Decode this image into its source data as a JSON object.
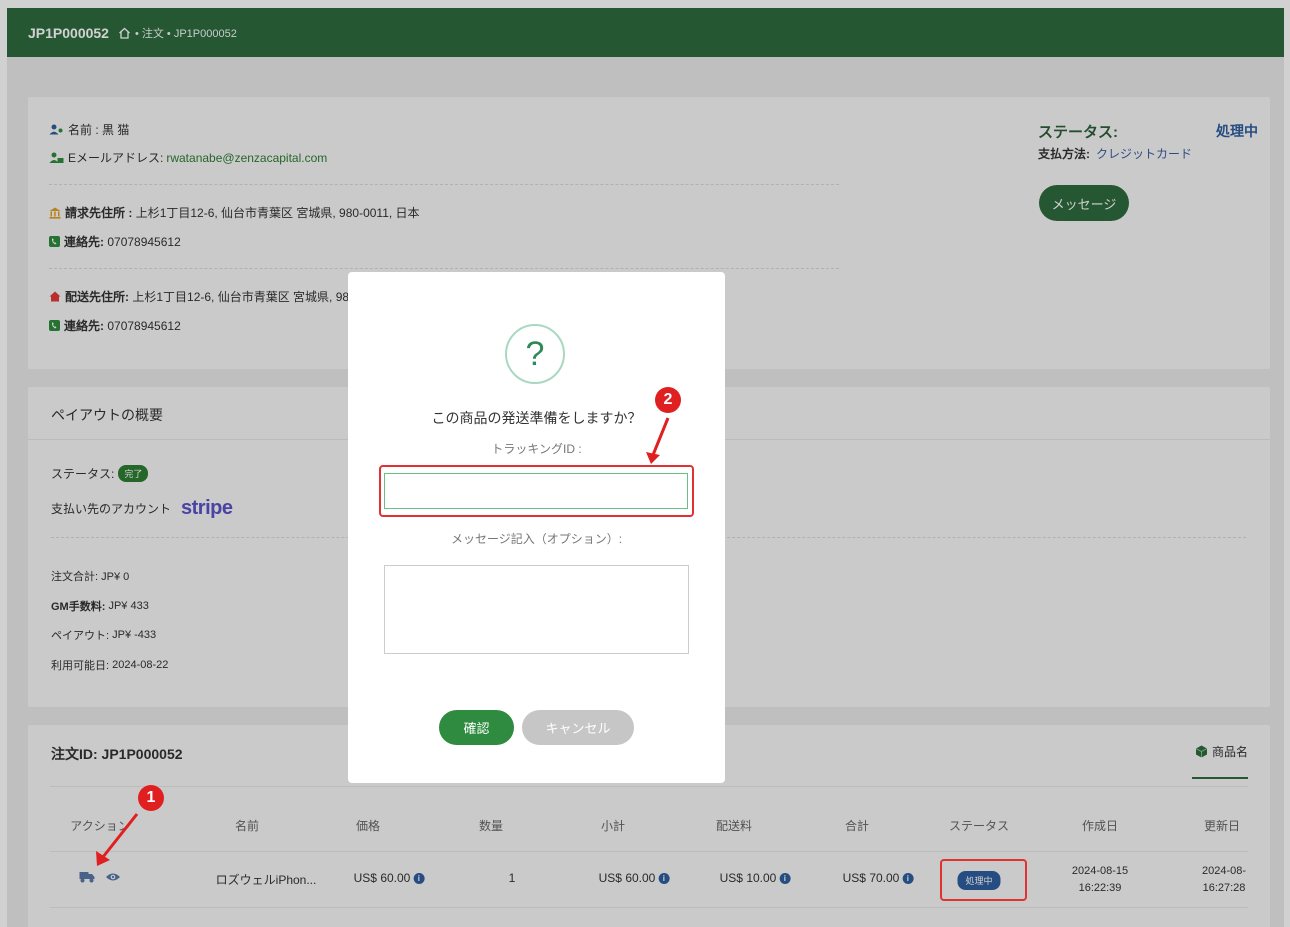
{
  "header": {
    "order_title": "JP1P000052",
    "breadcrumb": "• 注文 • JP1P000052"
  },
  "customer": {
    "name_label": "名前 :",
    "name_value": "黒 猫",
    "email_label": "Eメールアドレス:",
    "email_value": "rwatanabe@zenzacapital.com",
    "billing_label": "請求先住所 :",
    "billing_value": "上杉1丁目12-6, 仙台市青葉区 宮城県, 980-0011, 日本",
    "contact_label": "連絡先:",
    "contact_value": "07078945612",
    "shipping_label": "配送先住所:",
    "shipping_value": "上杉1丁目12-6, 仙台市青葉区 宮城県, 980",
    "contact2_label": "連絡先:",
    "contact2_value": "07078945612"
  },
  "status": {
    "title": "ステータス:",
    "value": "処理中",
    "payment_label": "支払方法:",
    "payment_value": "クレジットカード",
    "message_button": "メッセージ"
  },
  "payout": {
    "title": "ペイアウトの概要",
    "status_label": "ステータス:",
    "status_badge": "完了",
    "account_label": "支払い先のアカウント",
    "account_brand": "stripe",
    "order_total": "注文合計: JP¥ 0",
    "gm_fee_label": "GM手数料:",
    "gm_fee_value": "JP¥ 433",
    "payout_label": "ペイアウト:",
    "payout_value": "JP¥ -433",
    "available_label": "利用可能日:",
    "available_value": "2024-08-22"
  },
  "order": {
    "title": "注文ID: JP1P000052",
    "product_tab": "商品名",
    "columns": [
      "アクション",
      "名前",
      "価格",
      "数量",
      "小計",
      "配送料",
      "合計",
      "ステータス",
      "作成日",
      "更新日"
    ],
    "row": {
      "name": "ロズウェルiPhon...",
      "price": "US$ 60.00",
      "qty": "1",
      "subtotal": "US$ 60.00",
      "shipping": "US$ 10.00",
      "total": "US$ 70.00",
      "status": "処理中",
      "created_date": "2024-08-15",
      "created_time": "16:22:39",
      "updated_date": "2024-08-",
      "updated_time": "16:27:28"
    }
  },
  "modal": {
    "icon": "?",
    "question": "この商品の発送準備をしますか？",
    "tracking_label": "トラッキングID :",
    "tracking_value": "",
    "message_label": "メッセージ記入（オプション）:",
    "confirm": "確認",
    "cancel": "キャンセル"
  },
  "annotations": {
    "marker1": "1",
    "marker2": "2"
  }
}
